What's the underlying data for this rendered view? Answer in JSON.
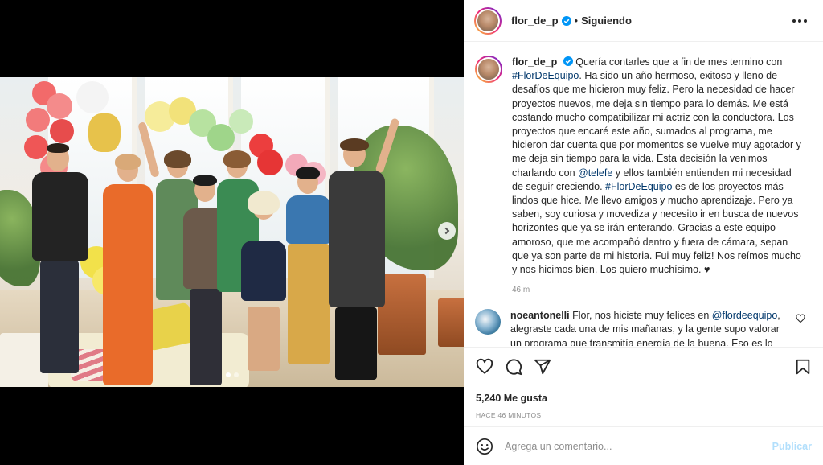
{
  "post": {
    "author": "flor_de_p",
    "follow_state": "Siguiendo",
    "bullet": "•",
    "media_count": 2,
    "media_index": 1
  },
  "caption": {
    "author": "flor_de_p",
    "parts": [
      {
        "text": "Quería contarles que a fin de mes termino con "
      },
      {
        "tag": "#FlorDeEquipo"
      },
      {
        "text": ". Ha sido un año hermoso, exitoso y lleno de desafíos que me hicieron muy feliz. Pero la necesidad de hacer proyectos nuevos, me deja sin tiempo para lo demás. Me está costando mucho compatibilizar mi actriz con la conductora. Los proyectos que encaré este año, sumados al programa, me hicieron dar cuenta que por momentos se vuelve muy agotador y me deja sin tiempo para la vida. Esta decisión la venimos charlando con "
      },
      {
        "tag": "@telefe"
      },
      {
        "text": " y ellos también entienden mi necesidad de seguir creciendo. "
      },
      {
        "tag": "#FlorDeEquipo"
      },
      {
        "text": " es de los proyectos más lindos que hice. Me llevo amigos y mucho aprendizaje. Pero ya saben, soy curiosa y movediza y necesito ir en busca de nuevos horizontes que ya se irán enterando. Gracias a este equipo amoroso, que me acompañó dentro y fuera de cámara, sepan que ya son parte de mi historia. Fui muy feliz! Nos reímos mucho y nos hicimos bien. Los quiero muchísimo. ♥"
      }
    ],
    "time": "46 m"
  },
  "comment": {
    "author": "noeantonelli",
    "parts": [
      {
        "text": "Flor, nos hiciste muy felices en "
      },
      {
        "tag": "@flordeequipo"
      },
      {
        "text": ", alegraste cada una de mis mañanas, y la gente supo valorar un programa que transmitía energía de la buena. Eso es lo único"
      }
    ]
  },
  "actions": {
    "likes": "5,240 Me gusta",
    "posted_ago": "HACE 46 MINUTOS"
  },
  "add_comment": {
    "placeholder": "Agrega un comentario...",
    "publish_label": "Publicar"
  },
  "colors": {
    "text": "#262626",
    "secondary": "#8e8e8e",
    "tag": "#00376b",
    "verified": "#0095f6",
    "publish_disabled": "#b2dffc"
  },
  "icons": [
    "verified-icon",
    "more-options-icon",
    "heart-icon",
    "comment-icon",
    "share-icon",
    "bookmark-icon",
    "emoji-icon",
    "carousel-next-icon"
  ]
}
